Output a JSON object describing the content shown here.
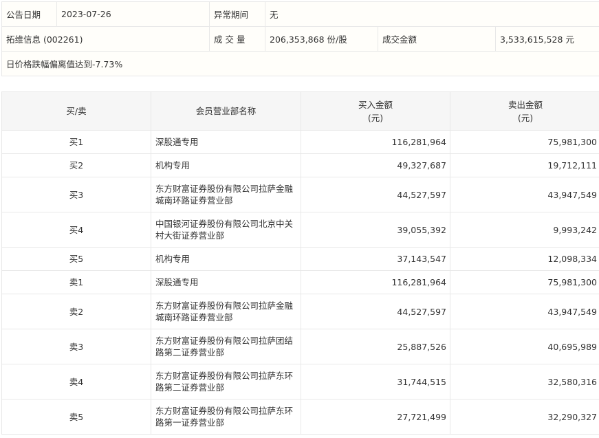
{
  "info": {
    "date_label": "公告日期",
    "date_value": "2023-07-26",
    "period_label": "异常期间",
    "period_value": "无",
    "stock_label": "拓维信息 (002261)",
    "volume_label": "成 交 量",
    "volume_value": "206,353,868 份/股",
    "amount_label": "成交金额",
    "amount_value": "3,533,615,528 元",
    "reason": "日价格跌幅偏离值达到-7.73%"
  },
  "table": {
    "headers": [
      "买/卖",
      "会员营业部名称",
      "买入金额\n(元)",
      "卖出金额\n(元)"
    ],
    "rows": [
      {
        "side": "买1",
        "name": "深股通专用",
        "buy": "116,281,964",
        "sell": "75,981,300"
      },
      {
        "side": "买2",
        "name": "机构专用",
        "buy": "49,327,687",
        "sell": "19,712,111"
      },
      {
        "side": "买3",
        "name": "东方财富证券股份有限公司拉萨金融城南环路证券营业部",
        "buy": "44,527,597",
        "sell": "43,947,549"
      },
      {
        "side": "买4",
        "name": "中国银河证券股份有限公司北京中关村大街证券营业部",
        "buy": "39,055,392",
        "sell": "9,993,242"
      },
      {
        "side": "买5",
        "name": "机构专用",
        "buy": "37,143,547",
        "sell": "12,098,334"
      },
      {
        "side": "卖1",
        "name": "深股通专用",
        "buy": "116,281,964",
        "sell": "75,981,300"
      },
      {
        "side": "卖2",
        "name": "东方财富证券股份有限公司拉萨金融城南环路证券营业部",
        "buy": "44,527,597",
        "sell": "43,947,549"
      },
      {
        "side": "卖3",
        "name": "东方财富证券股份有限公司拉萨团结路第二证券营业部",
        "buy": "25,887,526",
        "sell": "40,695,989"
      },
      {
        "side": "卖4",
        "name": "东方财富证券股份有限公司拉萨东环路第二证券营业部",
        "buy": "31,744,515",
        "sell": "32,580,316"
      },
      {
        "side": "卖5",
        "name": "东方财富证券股份有限公司拉萨东环路第一证券营业部",
        "buy": "27,721,499",
        "sell": "32,290,327"
      }
    ]
  }
}
